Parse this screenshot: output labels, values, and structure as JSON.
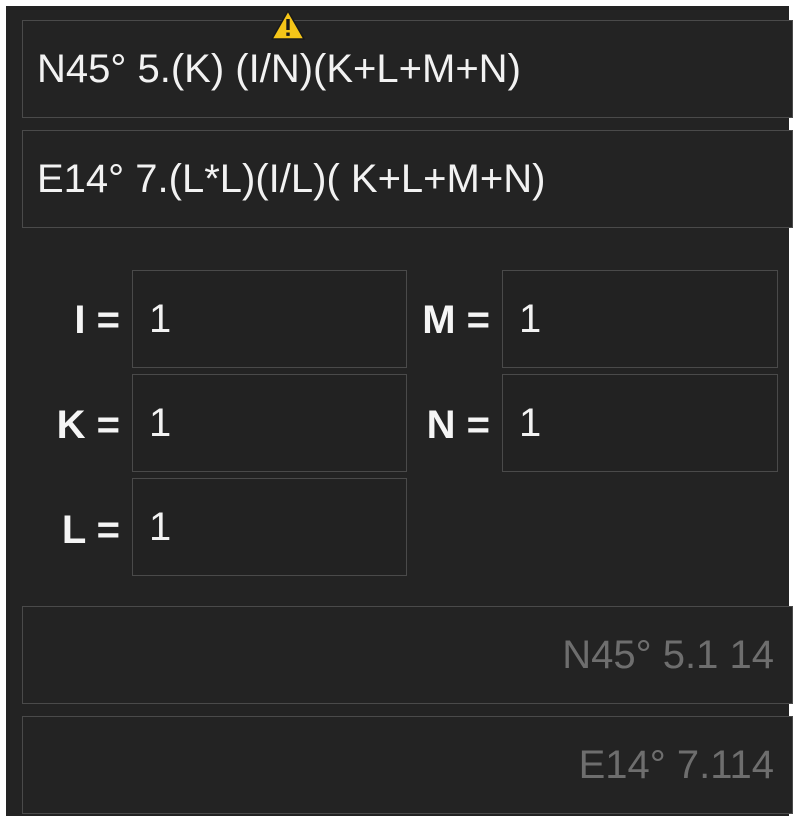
{
  "formulas": {
    "latitude": "N45° 5.(K) (I/N)(K+L+M+N)",
    "longitude": "E14° 7.(L*L)(I/L)( K+L+M+N)"
  },
  "warning_icon": "warning-triangle-icon",
  "variables": {
    "I": {
      "label": "I =",
      "value": "1"
    },
    "K": {
      "label": "K =",
      "value": "1"
    },
    "L": {
      "label": "L =",
      "value": "1"
    },
    "M": {
      "label": "M =",
      "value": "1"
    },
    "N": {
      "label": "N =",
      "value": "1"
    }
  },
  "results": {
    "latitude": "N45° 5.1 14",
    "longitude": "E14° 7.114"
  },
  "colors": {
    "background": "#232323",
    "border": "#4a4a4a",
    "text": "#f2f2f2",
    "result_text": "#6e6e6e",
    "warning": "#f5c518"
  }
}
